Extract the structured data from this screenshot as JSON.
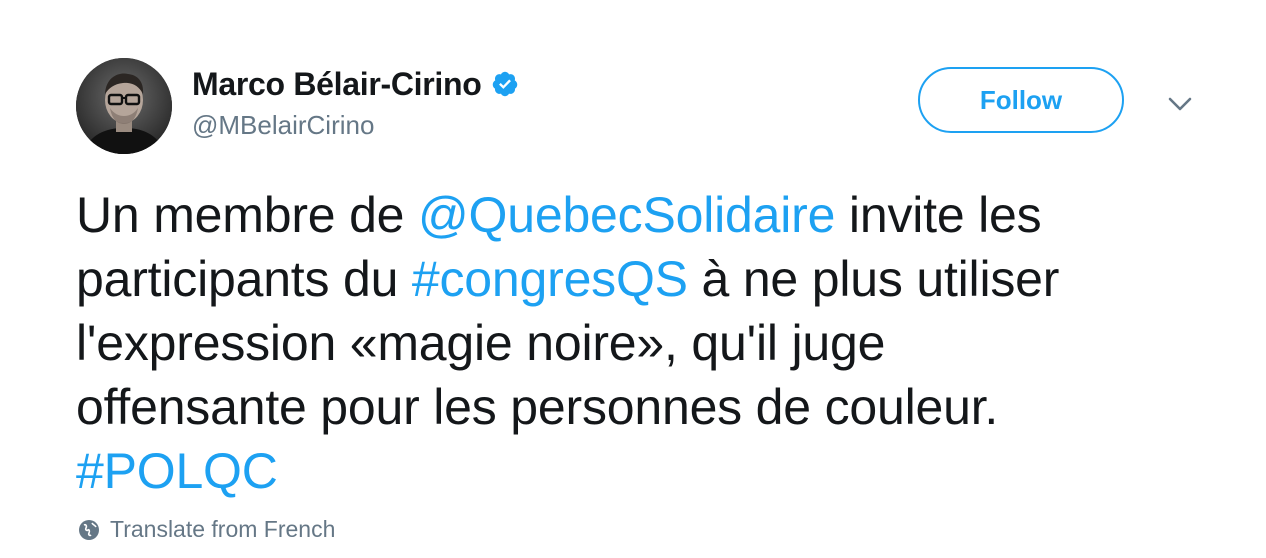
{
  "author": {
    "display_name": "Marco Bélair-Cirino",
    "handle": "@MBelairCirino",
    "verified": true
  },
  "actions": {
    "follow_label": "Follow",
    "menu_icon": "chevron-down-icon"
  },
  "tweet": {
    "line1": {
      "a": "Un membre de ",
      "mention": "@QuebecSolidaire",
      "b": " invite les"
    },
    "line2": {
      "a": "participants du ",
      "hashtag": "#congresQS",
      "b": " à ne plus utiliser"
    },
    "line3": "l'expression «magie noire», qu'il juge",
    "line4": "offensante pour les personnes de couleur.",
    "line5": {
      "hashtag": "#POLQC"
    }
  },
  "footer": {
    "translate_label": "Translate from French",
    "translate_icon": "globe-icon"
  },
  "colors": {
    "accent": "#1da1f2",
    "text": "#14171a",
    "secondary": "#657786"
  }
}
